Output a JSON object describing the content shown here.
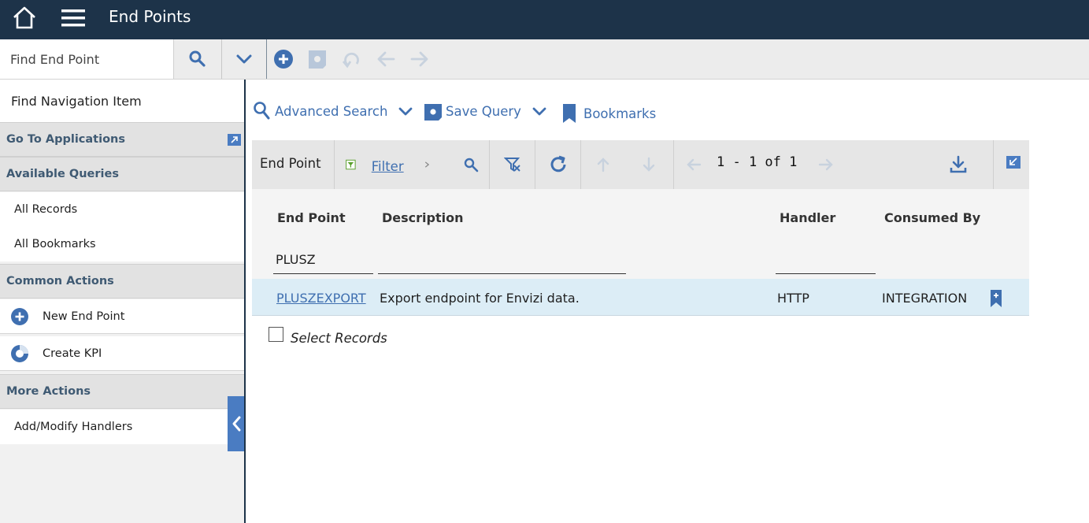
{
  "header": {
    "title": "End Points"
  },
  "toolbar": {
    "find_placeholder": "Find End Point"
  },
  "sidebar": {
    "find_nav_placeholder": "Find Navigation Item",
    "go_to_applications": "Go To Applications",
    "available_queries": {
      "heading": "Available Queries",
      "items": [
        "All Records",
        "All Bookmarks"
      ]
    },
    "common_actions": {
      "heading": "Common Actions",
      "items": [
        "New End Point",
        "Create KPI"
      ]
    },
    "more_actions": {
      "heading": "More Actions",
      "items": [
        "Add/Modify Handlers"
      ]
    }
  },
  "actions": {
    "advanced_search": "Advanced Search",
    "save_query": "Save Query",
    "bookmarks": "Bookmarks"
  },
  "grid": {
    "title": "End Point",
    "filter_label": "Filter",
    "pager": "1 - 1 of 1",
    "columns": [
      "End Point",
      "Description",
      "Handler",
      "Consumed By"
    ],
    "filter_values": {
      "end_point": "PLUSZ",
      "description": "",
      "handler": ""
    },
    "rows": [
      {
        "end_point": "PLUSZEXPORT",
        "description": "Export endpoint for Envizi data.",
        "handler": "HTTP",
        "consumed_by": "INTEGRATION"
      }
    ],
    "select_records": "Select Records"
  },
  "colors": {
    "topbar": "#1d3349",
    "accent": "#3f6fb0",
    "row_highlight": "#dcedf6",
    "collapse_tab": "#4a7cc2"
  }
}
